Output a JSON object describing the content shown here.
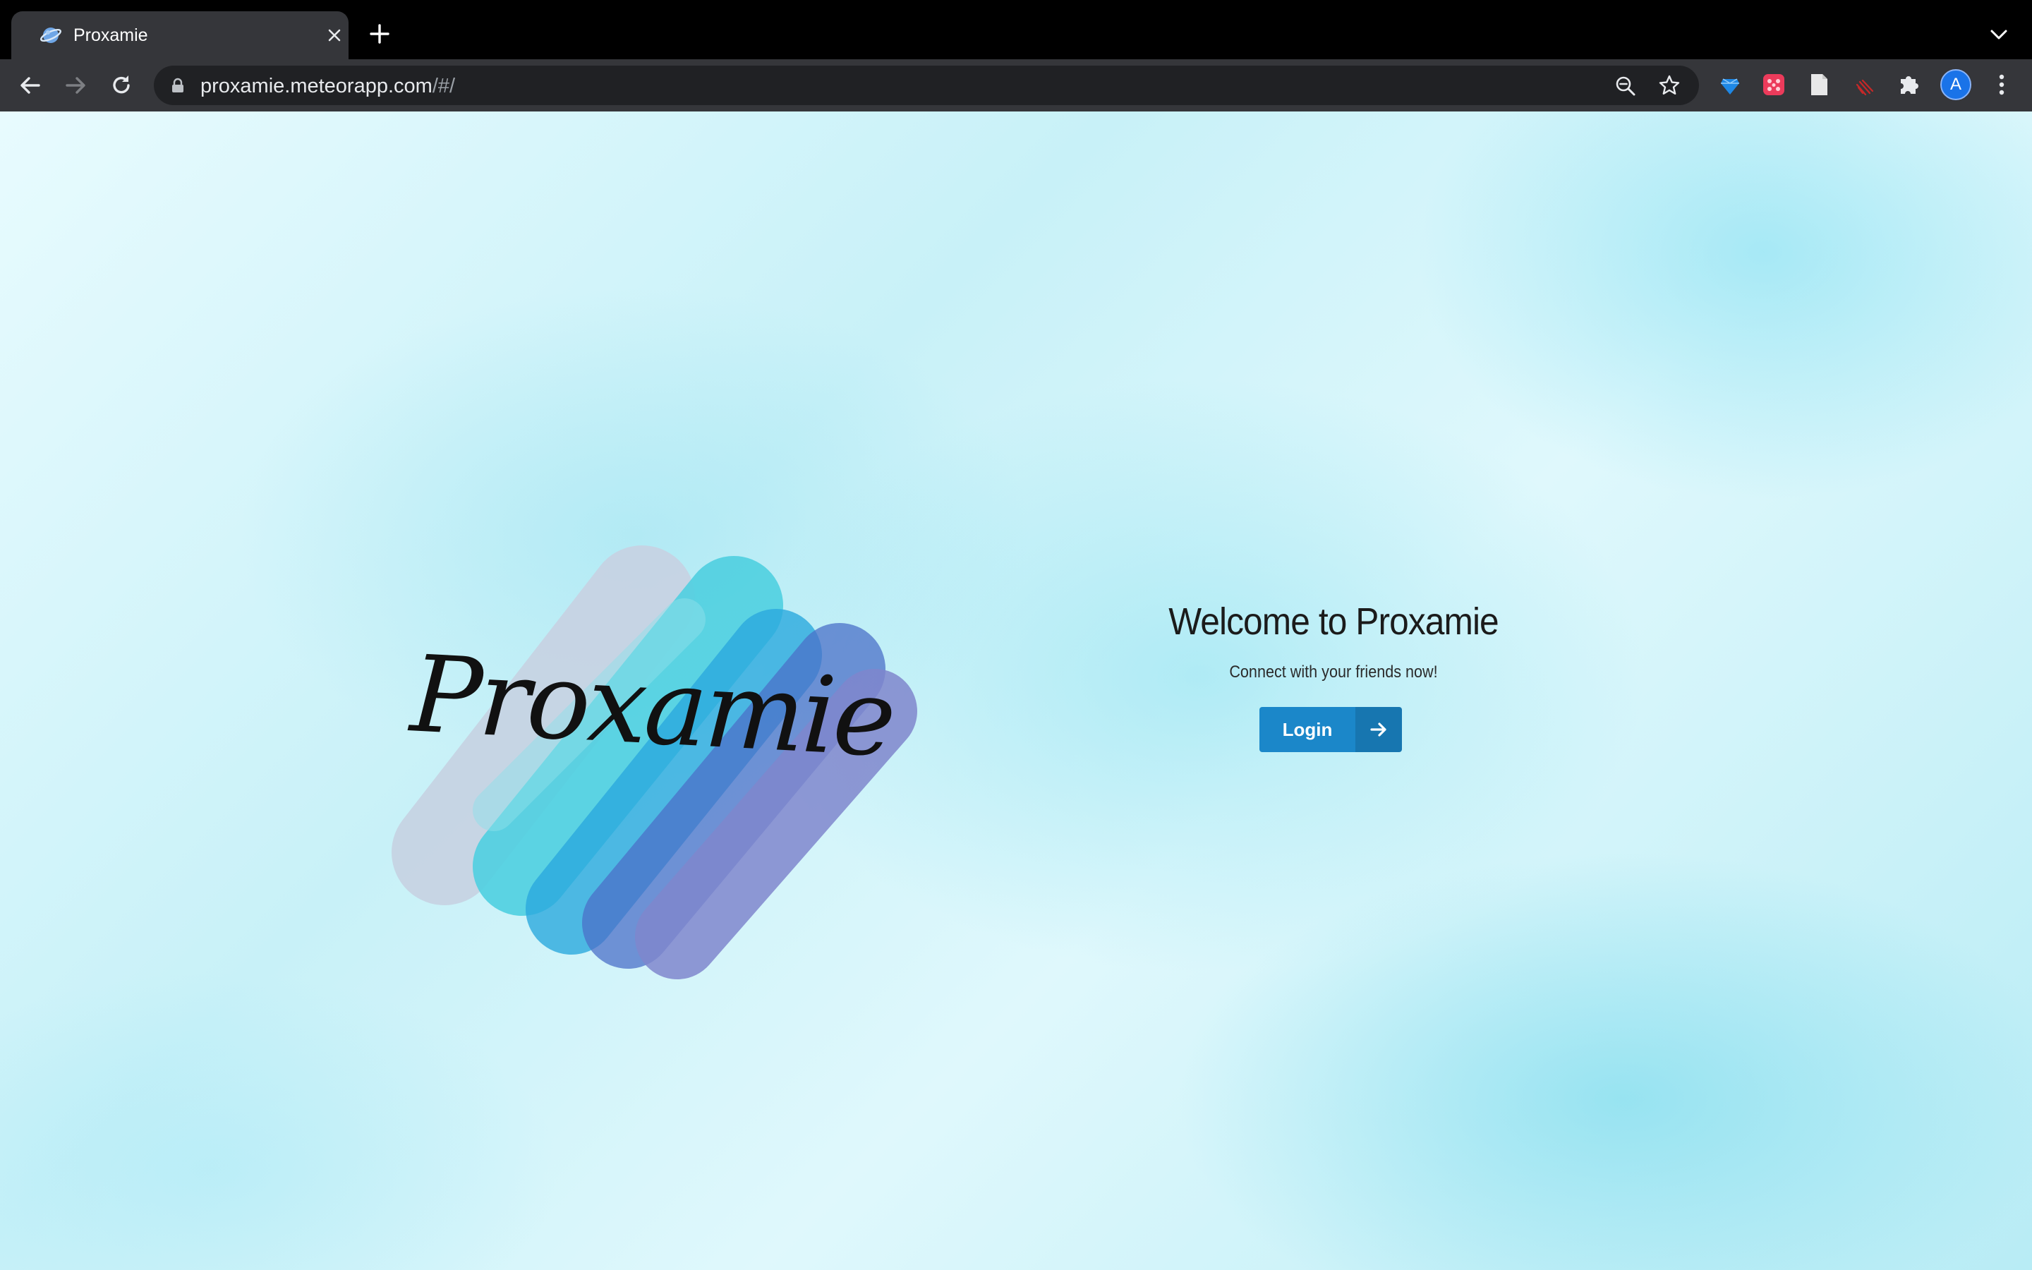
{
  "browser": {
    "tab": {
      "title": "Proxamie",
      "favicon": "meteor-app-icon"
    },
    "new_tab_icon": "plus-icon",
    "tab_search_icon": "chevron-down-icon",
    "address_bar": {
      "host": "proxamie.meteorapp.com",
      "path": "/#/"
    },
    "toolbar_icons": [
      "back-arrow-icon",
      "forward-arrow-icon",
      "reload-icon",
      "lock-icon",
      "zoom-out-icon",
      "star-icon"
    ],
    "extensions": [
      "gem-extension-icon",
      "red-dots-extension-icon",
      "document-extension-icon",
      "red-stripes-extension-icon",
      "puzzle-icon"
    ],
    "profile_initial": "A",
    "colors": {
      "tabstrip": "#000000",
      "toolbar": "#35363a",
      "omnibox": "#202124",
      "avatar": "#1a73e8"
    }
  },
  "page": {
    "logo_text": "Proxamie",
    "title": "Welcome to Proxamie",
    "subtitle": "Connect with your friends now!",
    "login_label": "Login",
    "colors": {
      "login_button": "#1b87c9",
      "background": "#c8f1f8",
      "logo_brush": [
        "#c6d3e3",
        "#4fcfe0",
        "#2aa9dd",
        "#4b70c8",
        "#7f86cc"
      ]
    }
  }
}
